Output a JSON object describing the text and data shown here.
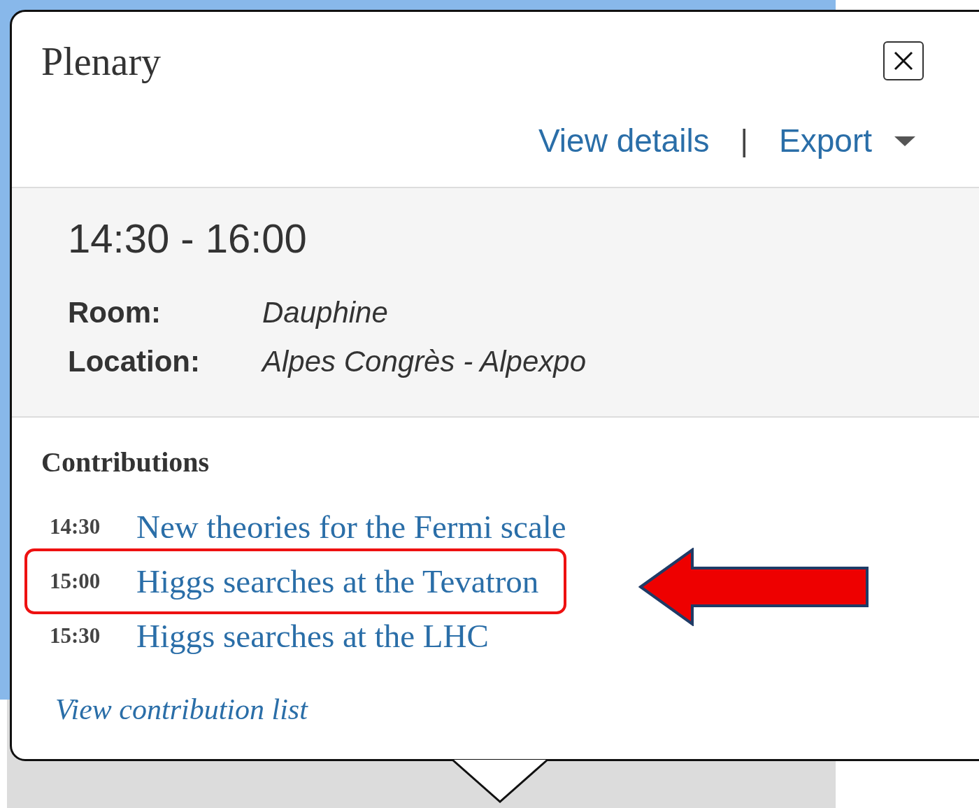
{
  "popup": {
    "title": "Plenary",
    "links": [
      {
        "label": "View details",
        "kind": "link"
      },
      {
        "label": "|",
        "kind": "separator"
      },
      {
        "label": "Export",
        "kind": "dropdown"
      }
    ],
    "time": "14:30 - 16:00",
    "details": [
      {
        "label": "Room:",
        "value": "Dauphine"
      },
      {
        "label": "Location:",
        "value": "Alpes Congrès - Alpexpo"
      }
    ],
    "contributions_heading": "Contributions",
    "contributions": [
      {
        "time": "14:30",
        "title": "New theories for the Fermi scale",
        "highlighted": false
      },
      {
        "time": "15:00",
        "title": "Higgs searches at the Tevatron",
        "highlighted": true
      },
      {
        "time": "15:30",
        "title": "Higgs searches at the LHC",
        "highlighted": false
      }
    ],
    "footer_link": "View contribution list"
  }
}
